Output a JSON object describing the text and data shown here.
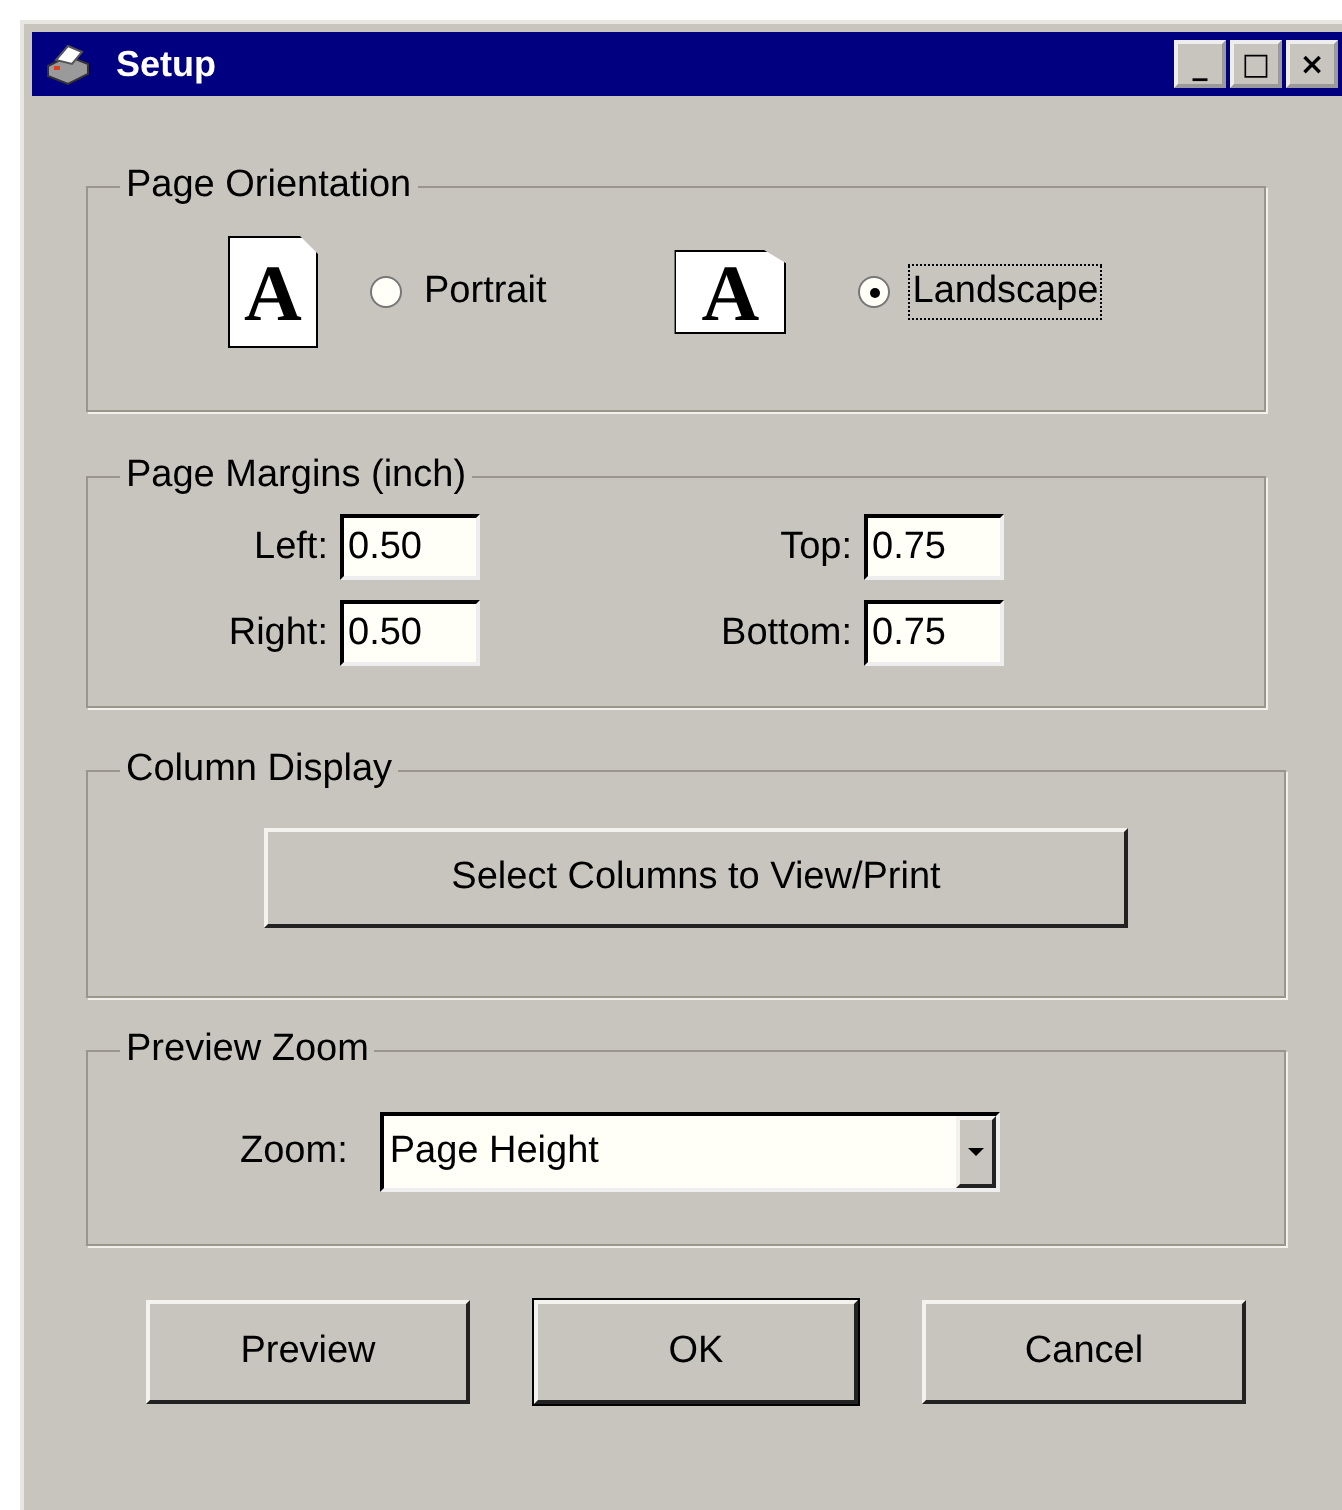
{
  "window": {
    "title": "Setup",
    "controls": [
      "_",
      "□",
      "×"
    ]
  },
  "orientation": {
    "legend": "Page Orientation",
    "options": [
      {
        "kind": "portrait",
        "glyph": "A",
        "label": "Portrait",
        "selected": false,
        "focused": false
      },
      {
        "kind": "landscape",
        "glyph": "A",
        "label": "Landscape",
        "selected": true,
        "focused": true
      }
    ]
  },
  "margins": {
    "legend": "Page Margins (inch)",
    "fields": [
      {
        "label": "Left:",
        "value": "0.50"
      },
      {
        "label": "Top:",
        "value": "0.75"
      },
      {
        "label": "Right:",
        "value": "0.50"
      },
      {
        "label": "Bottom:",
        "value": "0.75"
      }
    ]
  },
  "column_display": {
    "legend": "Column Display",
    "button": "Select Columns to View/Print"
  },
  "preview_zoom": {
    "legend": "Preview Zoom",
    "label": "Zoom:",
    "value": "Page Height"
  },
  "buttons": [
    {
      "label": "Preview",
      "default": false
    },
    {
      "label": "OK",
      "default": true
    },
    {
      "label": "Cancel",
      "default": false
    }
  ]
}
